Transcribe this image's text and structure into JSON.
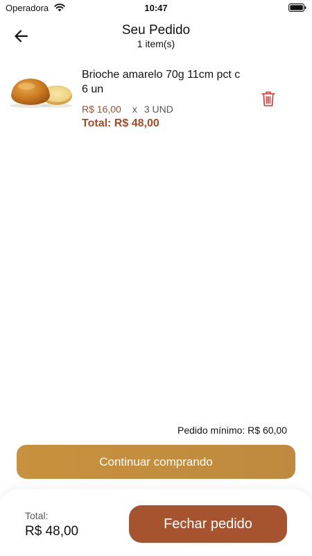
{
  "status_bar": {
    "carrier": "Operadora",
    "time": "10:47",
    "wifi_icon": "wifi-icon",
    "battery_icon": "battery-icon"
  },
  "header": {
    "back_icon": "arrow-left-icon",
    "title": "Seu Pedido",
    "subtitle": "1 item(s)"
  },
  "cart": {
    "items": [
      {
        "image": "brioche-bun-image",
        "name": "Brioche amarelo 70g 11cm pct c 6 un",
        "unit_price": "R$ 16,00",
        "times": "x",
        "quantity": "3 UND",
        "total": "Total: R$ 48,00",
        "delete_icon": "trash-icon"
      }
    ]
  },
  "minimum_order": "Pedido mínimo: R$ 60,00",
  "continue_button": "Continuar comprando",
  "footer": {
    "total_label": "Total:",
    "total_value": "R$ 48,00",
    "checkout_button": "Fechar pedido"
  },
  "colors": {
    "accent_price": "#a64b29",
    "continue_button": "#c58f3e",
    "checkout_button": "#a6532f",
    "trash_icon": "#e0332c"
  }
}
